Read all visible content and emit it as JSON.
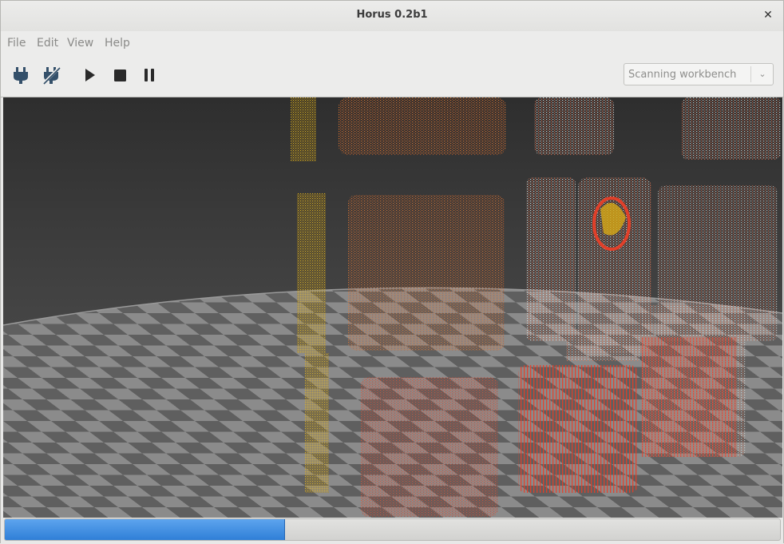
{
  "window": {
    "title": "Horus 0.2b1",
    "close_label": "✕"
  },
  "menu": {
    "items": [
      "File",
      "Edit",
      "View",
      "Help"
    ]
  },
  "toolbar": {
    "tools": [
      {
        "name": "connect-icon",
        "kind": "plug"
      },
      {
        "name": "disconnect-icon",
        "kind": "plug-off"
      },
      {
        "name": "play-icon",
        "kind": "play"
      },
      {
        "name": "stop-icon",
        "kind": "stop"
      },
      {
        "name": "pause-icon",
        "kind": "pause"
      }
    ],
    "workbench": {
      "selected": "Scanning workbench",
      "arrow": "⌄"
    }
  },
  "scan": {
    "progress": 0.36
  },
  "colors": {
    "accent": "#3b8be0",
    "point_red": "#e5462c",
    "point_orange": "#e0712f",
    "point_yellow": "#d8a915",
    "point_white": "#d9d4cf",
    "floor_light": "#8a8a8a",
    "floor_dark": "#5f5f5f"
  }
}
